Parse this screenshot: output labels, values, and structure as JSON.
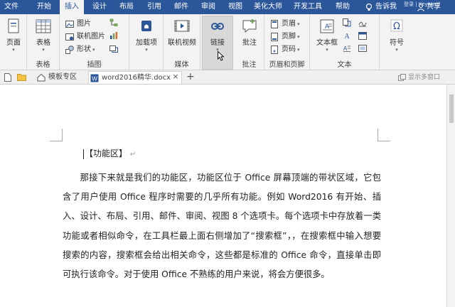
{
  "ribbon_tabs": [
    "文件",
    "开始",
    "插入",
    "设计",
    "布局",
    "引用",
    "邮件",
    "审阅",
    "视图",
    "美化大师",
    "开发工具",
    "帮助"
  ],
  "active_tab": "插入",
  "tell_me": "告诉我",
  "login": "登录 | Keyword",
  "share": "共享",
  "groups": {
    "pages": {
      "button": "页面",
      "label": ""
    },
    "tables": {
      "button": "表格",
      "label": "表格"
    },
    "illustrations": {
      "label": "插图",
      "items": [
        "图片",
        "联机图片",
        "形状"
      ]
    },
    "addins": {
      "button": "加载项",
      "label": ""
    },
    "media": {
      "button": "联机视频",
      "label": "媒体"
    },
    "links": {
      "button": "链接",
      "label": ""
    },
    "comments": {
      "button": "批注",
      "label": "批注"
    },
    "header_footer": {
      "label": "页眉和页脚",
      "items": [
        "页眉",
        "页脚",
        "页码"
      ]
    },
    "text": {
      "button": "文本框",
      "label": "文本"
    },
    "symbols": {
      "button": "符号",
      "label": ""
    }
  },
  "doc_tabs": [
    {
      "label": "模板专区"
    },
    {
      "label": "word2016精华.docx"
    }
  ],
  "multi_window": "显示多窗口",
  "document": {
    "heading": "【功能区】",
    "return_mark": "↵",
    "paragraph": "那接下来就是我们的功能区，功能区位于 Office 屏幕顶端的带状区域，它包含了用户使用 Office 程序时需要的几乎所有功能。例如 Word2016 有开始、插入、设计、布局、引用、邮件、审阅、视图 8 个选项卡。每个选项卡中存放着一类功能或者相似命令，在工具栏最上面右侧增加了“搜索框”，，在搜索框中输入想要搜索的内容，搜索框会给出相关命令，这些都是标准的 Office 命令，直接单击即可执行该命令。对于使用 Office 不熟练的用户来说，将会方便很多。"
  },
  "colors": {
    "accent": "#2b579a",
    "ribbon": "#f3f3f3"
  }
}
